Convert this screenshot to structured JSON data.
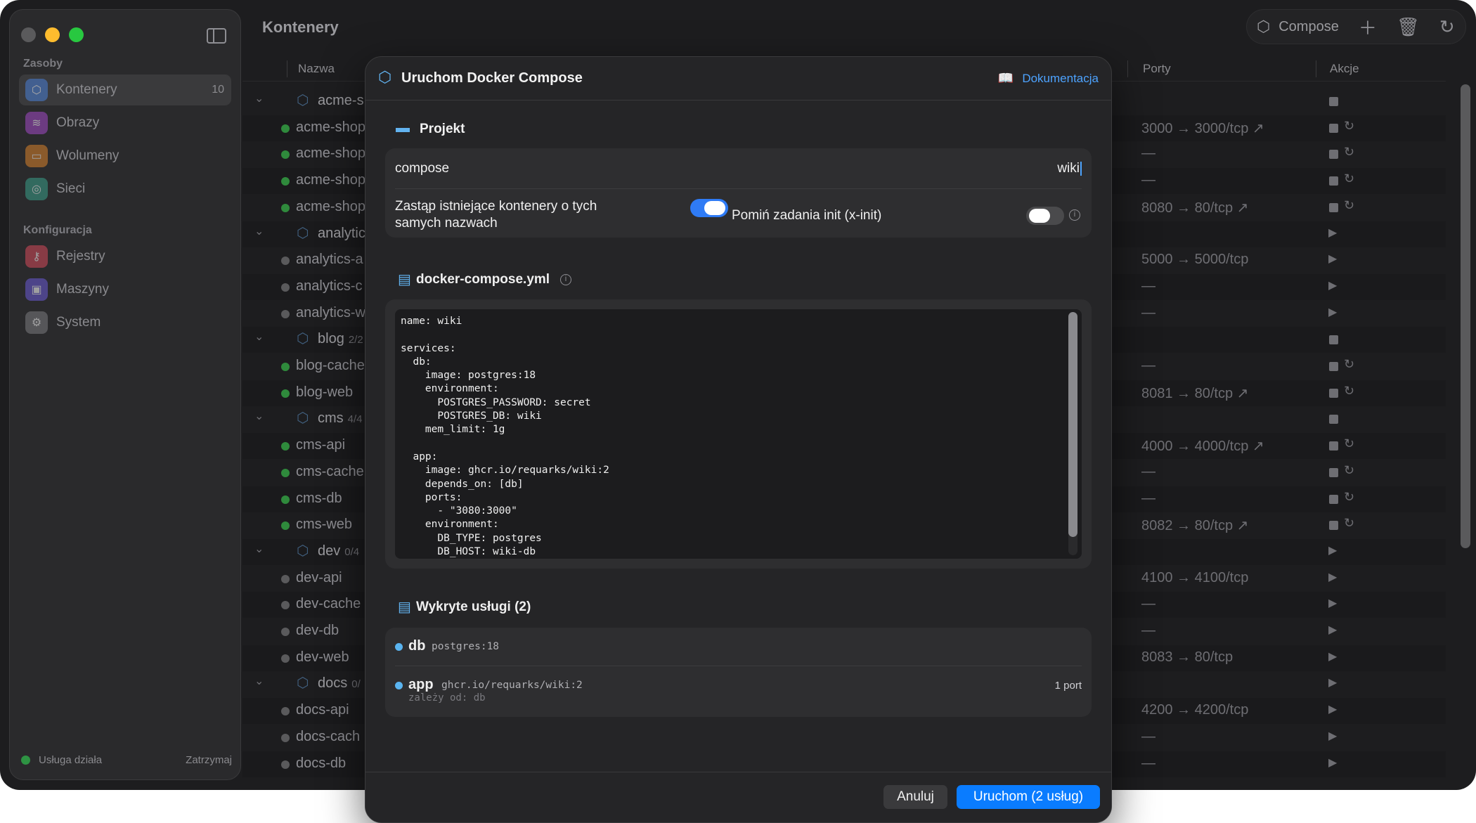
{
  "sidebar": {
    "sections": [
      {
        "label": "Zasoby",
        "items": [
          {
            "label": "Kontenery",
            "count": "10",
            "icon": "cube-icon",
            "color": "#4a7fd6"
          },
          {
            "label": "Obrazy",
            "icon": "layers-icon",
            "color": "#a24ac7"
          },
          {
            "label": "Wolumeny",
            "icon": "drive-icon",
            "color": "#d9822b"
          },
          {
            "label": "Sieci",
            "icon": "network-icon",
            "color": "#3aa08a"
          }
        ]
      },
      {
        "label": "Konfiguracja",
        "items": [
          {
            "label": "Rejestry",
            "icon": "key-icon",
            "color": "#d64a5a"
          },
          {
            "label": "Maszyny",
            "icon": "monitor-icon",
            "color": "#6a5ad6"
          },
          {
            "label": "System",
            "icon": "gear-icon",
            "color": "#7a7a7f"
          }
        ]
      }
    ],
    "footer": {
      "status": "Usługa działa",
      "action": "Zatrzymaj"
    }
  },
  "header": {
    "title": "Kontenery",
    "toolbar": {
      "compose_label": "Compose"
    }
  },
  "table": {
    "columns": {
      "name": "Nazwa",
      "ports": "Porty",
      "actions": "Akcje"
    },
    "rows": [
      {
        "kind": "group",
        "name": "acme-s",
        "count": ""
      },
      {
        "kind": "item",
        "name": "acme-shop",
        "state": "on",
        "port": "3000 → 3000/tcp ↗",
        "actions": "stop-restart"
      },
      {
        "kind": "item",
        "name": "acme-shop",
        "state": "on",
        "port": "—",
        "actions": "stop-restart"
      },
      {
        "kind": "item",
        "name": "acme-shop",
        "state": "on",
        "port": "—",
        "actions": "stop-restart"
      },
      {
        "kind": "item",
        "name": "acme-shop",
        "state": "on",
        "port": "8080 → 80/tcp ↗",
        "actions": "stop-restart"
      },
      {
        "kind": "group",
        "name": "analytic",
        "count": ""
      },
      {
        "kind": "item",
        "name": "analytics-a",
        "state": "off",
        "port": "5000 → 5000/tcp",
        "actions": "play"
      },
      {
        "kind": "item",
        "name": "analytics-c",
        "state": "off",
        "port": "—",
        "actions": "play"
      },
      {
        "kind": "item",
        "name": "analytics-w",
        "state": "off",
        "port": "—",
        "actions": "play"
      },
      {
        "kind": "group",
        "name": "blog",
        "count": "2/2"
      },
      {
        "kind": "item",
        "name": "blog-cache",
        "state": "on",
        "port": "—",
        "actions": "stop-restart"
      },
      {
        "kind": "item",
        "name": "blog-web",
        "state": "on",
        "port": "8081 → 80/tcp ↗",
        "actions": "stop-restart"
      },
      {
        "kind": "group",
        "name": "cms",
        "count": "4/4"
      },
      {
        "kind": "item",
        "name": "cms-api",
        "state": "on",
        "port": "4000 → 4000/tcp ↗",
        "actions": "stop-restart"
      },
      {
        "kind": "item",
        "name": "cms-cache",
        "state": "on",
        "port": "—",
        "actions": "stop-restart"
      },
      {
        "kind": "item",
        "name": "cms-db",
        "state": "on",
        "port": "—",
        "actions": "stop-restart"
      },
      {
        "kind": "item",
        "name": "cms-web",
        "state": "on",
        "port": "8082 → 80/tcp ↗",
        "actions": "stop-restart"
      },
      {
        "kind": "group",
        "name": "dev",
        "count": "0/4"
      },
      {
        "kind": "item",
        "name": "dev-api",
        "state": "off",
        "port": "4100 → 4100/tcp",
        "actions": "play"
      },
      {
        "kind": "item",
        "name": "dev-cache",
        "state": "off",
        "port": "—",
        "actions": "play"
      },
      {
        "kind": "item",
        "name": "dev-db",
        "state": "off",
        "port": "—",
        "actions": "play"
      },
      {
        "kind": "item",
        "name": "dev-web",
        "state": "off",
        "port": "8083 → 80/tcp",
        "actions": "play"
      },
      {
        "kind": "group",
        "name": "docs",
        "count": "0/"
      },
      {
        "kind": "item",
        "name": "docs-api",
        "state": "off",
        "port": "4200 → 4200/tcp",
        "actions": "play"
      },
      {
        "kind": "item",
        "name": "docs-cach",
        "state": "off",
        "port": "—",
        "actions": "play"
      },
      {
        "kind": "item",
        "name": "docs-db",
        "state": "off",
        "port": "—",
        "actions": "play"
      }
    ]
  },
  "modal": {
    "title": "Uruchom Docker Compose",
    "docs_link": "Dokumentacja",
    "project": {
      "section_title": "Projekt",
      "field_label": "compose",
      "field_value": "wiki",
      "replace_label": "Zastąp istniejące kontenery o tych samych nazwach",
      "replace_on": true,
      "skip_init_label": "Pomiń zadania init (x-init)",
      "skip_init_on": false
    },
    "file": {
      "section_title": "docker-compose.yml",
      "content": "name: wiki\n\nservices:\n  db:\n    image: postgres:18\n    environment:\n      POSTGRES_PASSWORD: secret\n      POSTGRES_DB: wiki\n    mem_limit: 1g\n\n  app:\n    image: ghcr.io/requarks/wiki:2\n    depends_on: [db]\n    ports:\n      - \"3080:3000\"\n    environment:\n      DB_TYPE: postgres\n      DB_HOST: wiki-db\n      DB_PASS: secret"
    },
    "services": {
      "section_title": "Wykryte usługi (2)",
      "items": [
        {
          "name": "db",
          "image": "postgres:18",
          "depends": "",
          "ports": ""
        },
        {
          "name": "app",
          "image": "ghcr.io/requarks/wiki:2",
          "depends": "zależy od: db",
          "ports": "1 port"
        }
      ]
    },
    "buttons": {
      "cancel": "Anuluj",
      "run": "Uruchom (2 usług)"
    }
  }
}
